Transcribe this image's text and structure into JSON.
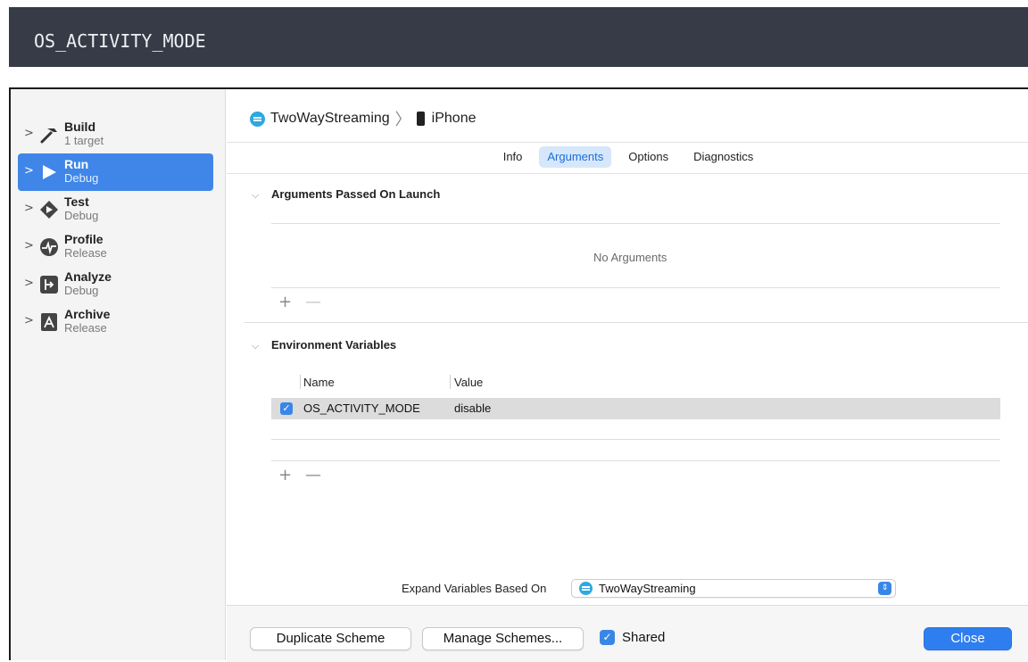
{
  "banner": {
    "code": "OS_ACTIVITY_MODE"
  },
  "sidebar": {
    "items": [
      {
        "title": "Build",
        "subtitle": "1 target",
        "icon": "hammer-icon",
        "active": false
      },
      {
        "title": "Run",
        "subtitle": "Debug",
        "icon": "play-icon",
        "active": true
      },
      {
        "title": "Test",
        "subtitle": "Debug",
        "icon": "test-diamond-icon",
        "active": false
      },
      {
        "title": "Profile",
        "subtitle": "Release",
        "icon": "pulse-icon",
        "active": false
      },
      {
        "title": "Analyze",
        "subtitle": "Debug",
        "icon": "analyze-icon",
        "active": false
      },
      {
        "title": "Archive",
        "subtitle": "Release",
        "icon": "archive-icon",
        "active": false
      }
    ]
  },
  "header": {
    "project": "TwoWayStreaming",
    "separator": "〉",
    "device": "iPhone"
  },
  "tabs": [
    {
      "label": "Info",
      "active": false
    },
    {
      "label": "Arguments",
      "active": true
    },
    {
      "label": "Options",
      "active": false
    },
    {
      "label": "Diagnostics",
      "active": false
    }
  ],
  "arguments": {
    "title": "Arguments Passed On Launch",
    "empty_text": "No Arguments",
    "add": "+",
    "remove": "—"
  },
  "env": {
    "title": "Environment Variables",
    "col_name": "Name",
    "col_value": "Value",
    "rows": [
      {
        "enabled": true,
        "name": "OS_ACTIVITY_MODE",
        "value": "disable"
      }
    ],
    "add": "+",
    "remove": "—"
  },
  "expand": {
    "label": "Expand Variables Based On",
    "selected": "TwoWayStreaming"
  },
  "footer": {
    "duplicate": "Duplicate Scheme",
    "manage": "Manage Schemes...",
    "shared_label": "Shared",
    "shared_checked": true,
    "close": "Close"
  },
  "colors": {
    "accent": "#3f86e8",
    "banner_bg": "#363b47",
    "tab_active_bg": "#d7e7fb"
  }
}
